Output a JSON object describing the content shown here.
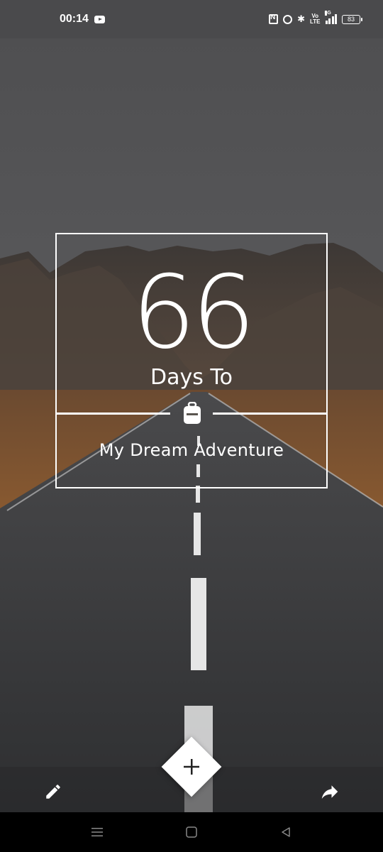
{
  "status_bar": {
    "time": "00:14",
    "battery_level": "83",
    "network": "5G",
    "volte_top": "Vo",
    "volte_bottom": "LTE",
    "icons": [
      "youtube-icon",
      "nfc-icon",
      "alarm-icon",
      "bluetooth-icon",
      "volte-icon",
      "signal-icon",
      "battery-icon"
    ]
  },
  "counter": {
    "number": "66",
    "label": "Days To",
    "event_title": "My Dream Adventure",
    "event_icon": "backpack-icon"
  },
  "toolbar": {
    "left_icon": "pencil-icon",
    "center_icon": "plus-icon",
    "right_icon": "share-icon"
  },
  "nav_bar": {
    "icons": [
      "menu-icon",
      "home-icon",
      "back-icon"
    ]
  },
  "colors": {
    "status_bar_bg": "#4a4a4c",
    "frame": "#ffffff",
    "sky": "#5a5a5c",
    "road": "#3a3b3d",
    "grass": "#7a4e2a"
  }
}
